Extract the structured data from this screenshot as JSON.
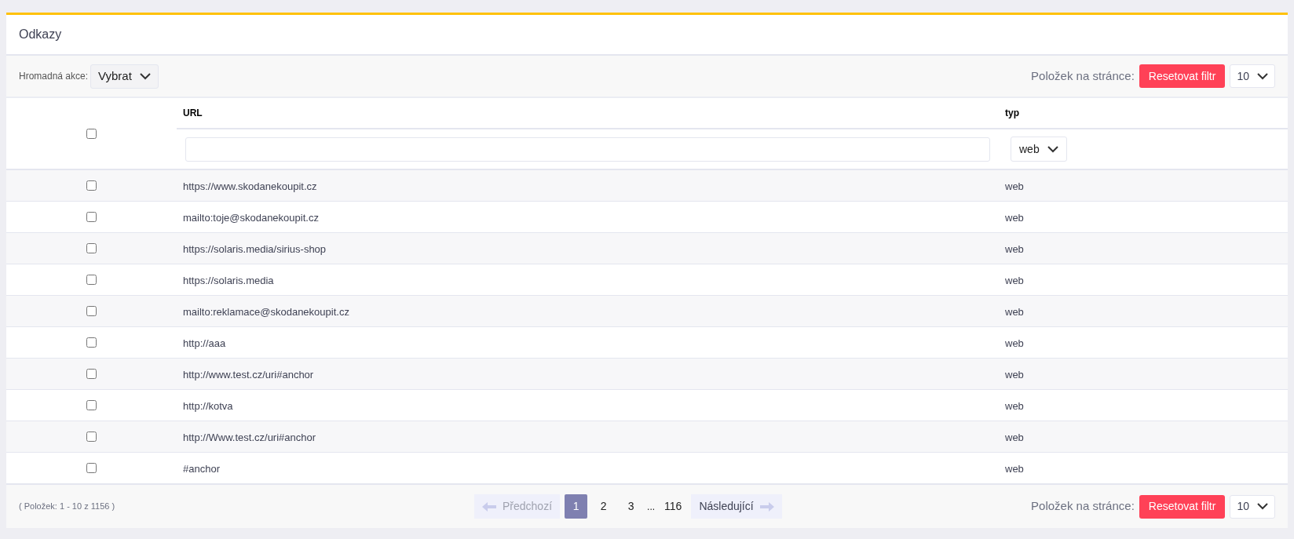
{
  "panel": {
    "title": "Odkazy"
  },
  "toolbar": {
    "bulk_label": "Hromadná akce:",
    "bulk_select": "Vybrat",
    "per_page_label": "Položek na stránce:",
    "reset_button": "Resetovat filtr",
    "per_page_select": "10"
  },
  "table": {
    "select_all_checked": false,
    "columns": [
      {
        "label": "URL",
        "kind": "text"
      },
      {
        "label": "typ",
        "kind": "select",
        "filter_value": "web"
      }
    ],
    "rows": [
      {
        "checked": false,
        "url": "https://www.skodanekoupit.cz",
        "type": "web"
      },
      {
        "checked": false,
        "url": "mailto:toje@skodanekoupit.cz",
        "type": "web"
      },
      {
        "checked": false,
        "url": "https://solaris.media/sirius-shop",
        "type": "web"
      },
      {
        "checked": false,
        "url": "https://solaris.media",
        "type": "web"
      },
      {
        "checked": false,
        "url": "mailto:reklamace@skodanekoupit.cz",
        "type": "web"
      },
      {
        "checked": false,
        "url": "http://aaa",
        "type": "web"
      },
      {
        "checked": false,
        "url": "http://www.test.cz/uri#anchor",
        "type": "web"
      },
      {
        "checked": false,
        "url": "http://kotva",
        "type": "web"
      },
      {
        "checked": false,
        "url": "http://Www.test.cz/uri#anchor",
        "type": "web"
      },
      {
        "checked": false,
        "url": "#anchor",
        "type": "web"
      }
    ]
  },
  "footer": {
    "summary": "( Položek: 1 - 10 z 1156 )",
    "prev": {
      "label": "Předchozí",
      "disabled": true
    },
    "pages": [
      {
        "kind": "page",
        "label": "1",
        "selected": true
      },
      {
        "kind": "page",
        "label": "2",
        "selected": false
      },
      {
        "kind": "page",
        "label": "3",
        "selected": false
      },
      {
        "kind": "ellipsis",
        "label": "..."
      },
      {
        "kind": "page",
        "label": "116",
        "selected": false
      }
    ],
    "next": {
      "label": "Následující",
      "disabled": false
    },
    "per_page_label": "Položek na stránce:",
    "reset_button": "Resetovat filtr",
    "per_page_select": "10"
  }
}
